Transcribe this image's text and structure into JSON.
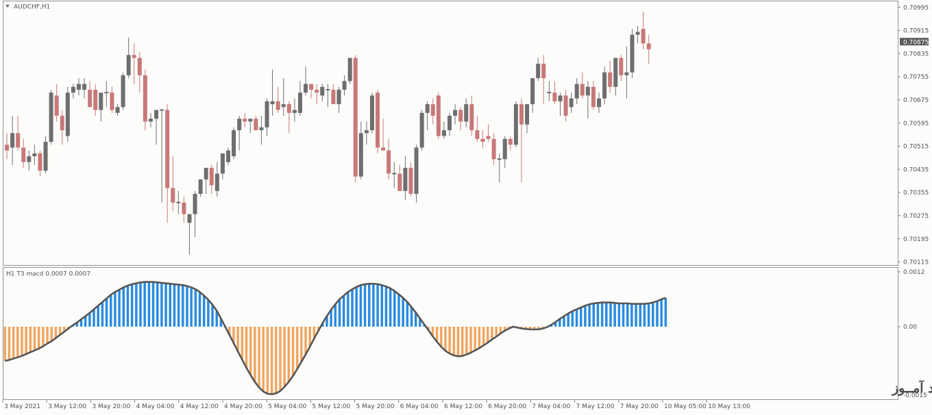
{
  "window": {
    "symbol_title": "AUDCHF,H1",
    "indicator_title": "H1 T3 macd 0.0007 0.0007",
    "watermark": "انتشار در وبسایت ســود آمــوز"
  },
  "colors": {
    "background": "#fcfcfa",
    "bull_candle": "#6e6e6e",
    "bear_candle": "#c87878",
    "pos_hist": "#2a8ce0",
    "neg_hist": "#f0a660",
    "macd_line": "#555555",
    "current_price_bg": "#5a5a5a"
  },
  "chart_data": [
    {
      "type": "candlestick",
      "title": "AUDCHF,H1",
      "price_axis": {
        "ticks": [
          "0.70995",
          "0.70915",
          "0.70835",
          "0.70755",
          "0.70675",
          "0.70595",
          "0.70515",
          "0.70435",
          "0.70355",
          "0.70275",
          "0.70195",
          "0.70115"
        ],
        "current_price": "0.70875",
        "ylim": [
          0.7011,
          0.71
        ],
        "grid": false
      },
      "time_axis": {
        "labels": [
          "3 May 2021",
          "3 May 12:00",
          "3 May 20:00",
          "4 May 04:00",
          "4 May 12:00",
          "4 May 20:00",
          "5 May 04:00",
          "5 May 12:00",
          "5 May 20:00",
          "6 May 04:00",
          "6 May 12:00",
          "6 May 20:00",
          "7 May 04:00",
          "7 May 12:00",
          "7 May 20:00",
          "10 May 05:00",
          "10 May 13:00"
        ]
      },
      "candles": [
        [
          0.7052,
          0.7056,
          0.7047,
          0.705
        ],
        [
          0.7051,
          0.7062,
          0.7045,
          0.7056
        ],
        [
          0.7056,
          0.7062,
          0.705,
          0.7051
        ],
        [
          0.7051,
          0.7054,
          0.7044,
          0.7046
        ],
        [
          0.7046,
          0.705,
          0.7043,
          0.7048
        ],
        [
          0.7048,
          0.7052,
          0.7045,
          0.7049
        ],
        [
          0.7049,
          0.705,
          0.7041,
          0.7043
        ],
        [
          0.7043,
          0.7055,
          0.7042,
          0.7053
        ],
        [
          0.7053,
          0.7071,
          0.7052,
          0.707
        ],
        [
          0.7069,
          0.7073,
          0.706,
          0.7062
        ],
        [
          0.7062,
          0.7064,
          0.7052,
          0.7057
        ],
        [
          0.7055,
          0.7072,
          0.7053,
          0.707
        ],
        [
          0.707,
          0.7073,
          0.7068,
          0.7072
        ],
        [
          0.7071,
          0.7075,
          0.7069,
          0.7073
        ],
        [
          0.7071,
          0.7075,
          0.7068,
          0.7073
        ],
        [
          0.7071,
          0.7074,
          0.7066,
          0.7065
        ],
        [
          0.7071,
          0.7073,
          0.7062,
          0.7064
        ],
        [
          0.7064,
          0.7066,
          0.706,
          0.707
        ],
        [
          0.707,
          0.7074,
          0.7065,
          0.707
        ],
        [
          0.707,
          0.7072,
          0.7063,
          0.7064
        ],
        [
          0.7063,
          0.7066,
          0.7062,
          0.7065
        ],
        [
          0.7065,
          0.7077,
          0.7064,
          0.7076
        ],
        [
          0.7076,
          0.7089,
          0.7075,
          0.7083
        ],
        [
          0.7083,
          0.7087,
          0.7073,
          0.7082
        ],
        [
          0.7082,
          0.7084,
          0.707,
          0.7076
        ],
        [
          0.7076,
          0.7078,
          0.7057,
          0.706
        ],
        [
          0.706,
          0.7063,
          0.7058,
          0.7061
        ],
        [
          0.7061,
          0.7064,
          0.7052,
          0.7064
        ],
        [
          0.7064,
          0.7064,
          0.7032,
          0.7064
        ],
        [
          0.7064,
          0.7066,
          0.7025,
          0.7037
        ],
        [
          0.7037,
          0.7048,
          0.7029,
          0.7032
        ],
        [
          0.7032,
          0.7036,
          0.7028,
          0.7032
        ],
        [
          0.7032,
          0.7034,
          0.7025,
          0.7028
        ],
        [
          0.7025,
          0.7028,
          0.7014,
          0.7028
        ],
        [
          0.7028,
          0.7036,
          0.702,
          0.7035
        ],
        [
          0.7035,
          0.704,
          0.7034,
          0.704
        ],
        [
          0.704,
          0.7042,
          0.7035,
          0.7044
        ],
        [
          0.7044,
          0.7045,
          0.7035,
          0.7038
        ],
        [
          0.7036,
          0.7046,
          0.7034,
          0.7042
        ],
        [
          0.7042,
          0.7049,
          0.704,
          0.7049
        ],
        [
          0.7046,
          0.7051,
          0.7045,
          0.705
        ],
        [
          0.7048,
          0.7058,
          0.7047,
          0.7057
        ],
        [
          0.7057,
          0.7062,
          0.705,
          0.7061
        ],
        [
          0.7061,
          0.7063,
          0.7058,
          0.706
        ],
        [
          0.706,
          0.706,
          0.7056,
          0.7061
        ],
        [
          0.7061,
          0.7062,
          0.7058,
          0.7057
        ],
        [
          0.7057,
          0.7062,
          0.7052,
          0.7058
        ],
        [
          0.7058,
          0.7068,
          0.7055,
          0.7067
        ],
        [
          0.7066,
          0.7078,
          0.7062,
          0.7067
        ],
        [
          0.7067,
          0.7072,
          0.7063,
          0.7064
        ],
        [
          0.7065,
          0.7075,
          0.7062,
          0.7066
        ],
        [
          0.7066,
          0.7067,
          0.7056,
          0.7063
        ],
        [
          0.7063,
          0.7068,
          0.706,
          0.7064
        ],
        [
          0.7063,
          0.7074,
          0.7062,
          0.707
        ],
        [
          0.707,
          0.7079,
          0.7069,
          0.7073
        ],
        [
          0.7073,
          0.7073,
          0.7068,
          0.7071
        ],
        [
          0.7071,
          0.7073,
          0.7066,
          0.707
        ],
        [
          0.7069,
          0.7073,
          0.7067,
          0.7072
        ],
        [
          0.7071,
          0.7073,
          0.7065,
          0.7071
        ],
        [
          0.7071,
          0.7073,
          0.7067,
          0.7066
        ],
        [
          0.7066,
          0.7072,
          0.7063,
          0.7071
        ],
        [
          0.7071,
          0.7076,
          0.7069,
          0.7074
        ],
        [
          0.7074,
          0.7082,
          0.7073,
          0.7082
        ],
        [
          0.7082,
          0.7083,
          0.7039,
          0.7041
        ],
        [
          0.7041,
          0.706,
          0.704,
          0.7056
        ],
        [
          0.7056,
          0.706,
          0.7052,
          0.7057
        ],
        [
          0.7057,
          0.707,
          0.7056,
          0.7069
        ],
        [
          0.707,
          0.7071,
          0.7049,
          0.7051
        ],
        [
          0.7051,
          0.7061,
          0.705,
          0.705
        ],
        [
          0.705,
          0.7054,
          0.704,
          0.7042
        ],
        [
          0.7042,
          0.7046,
          0.7037,
          0.7042
        ],
        [
          0.7042,
          0.7045,
          0.7036,
          0.7036
        ],
        [
          0.7036,
          0.7048,
          0.7033,
          0.7044
        ],
        [
          0.7044,
          0.7046,
          0.7034,
          0.7035
        ],
        [
          0.7035,
          0.7052,
          0.7032,
          0.7051
        ],
        [
          0.7051,
          0.7064,
          0.705,
          0.7063
        ],
        [
          0.7063,
          0.7067,
          0.7057,
          0.7066
        ],
        [
          0.7066,
          0.7068,
          0.7059,
          0.7062
        ],
        [
          0.7069,
          0.707,
          0.7054,
          0.7055
        ],
        [
          0.7055,
          0.706,
          0.7054,
          0.7057
        ],
        [
          0.7057,
          0.7063,
          0.7055,
          0.7062
        ],
        [
          0.7062,
          0.7066,
          0.7059,
          0.7064
        ],
        [
          0.7064,
          0.7065,
          0.7057,
          0.706
        ],
        [
          0.706,
          0.7068,
          0.7058,
          0.7066
        ],
        [
          0.7066,
          0.7069,
          0.7055,
          0.7057
        ],
        [
          0.7057,
          0.7062,
          0.7053,
          0.7054
        ],
        [
          0.7054,
          0.7057,
          0.7051,
          0.7053
        ],
        [
          0.7055,
          0.7059,
          0.7053,
          0.7054
        ],
        [
          0.7054,
          0.7056,
          0.7045,
          0.7047
        ],
        [
          0.7047,
          0.7049,
          0.7039,
          0.7047
        ],
        [
          0.7047,
          0.7055,
          0.7044,
          0.7054
        ],
        [
          0.7054,
          0.7055,
          0.705,
          0.7052
        ],
        [
          0.7052,
          0.7067,
          0.7051,
          0.7066
        ],
        [
          0.7066,
          0.7068,
          0.7039,
          0.7059
        ],
        [
          0.7059,
          0.7066,
          0.7056,
          0.7066
        ],
        [
          0.7066,
          0.7073,
          0.7063,
          0.7075
        ],
        [
          0.7075,
          0.7082,
          0.7074,
          0.708
        ],
        [
          0.708,
          0.7083,
          0.7066,
          0.7075
        ],
        [
          0.707,
          0.7074,
          0.7067,
          0.707
        ],
        [
          0.707,
          0.7074,
          0.7066,
          0.7067
        ],
        [
          0.7067,
          0.707,
          0.7062,
          0.7069
        ],
        [
          0.7069,
          0.7071,
          0.706,
          0.7062
        ],
        [
          0.7065,
          0.707,
          0.7063,
          0.7068
        ],
        [
          0.7068,
          0.7075,
          0.7066,
          0.7073
        ],
        [
          0.7073,
          0.7077,
          0.7068,
          0.7069
        ],
        [
          0.7069,
          0.7074,
          0.7061,
          0.7072
        ],
        [
          0.7072,
          0.7074,
          0.7064,
          0.7065
        ],
        [
          0.7065,
          0.707,
          0.7063,
          0.7068
        ],
        [
          0.7068,
          0.7079,
          0.7066,
          0.7077
        ],
        [
          0.7077,
          0.7081,
          0.707,
          0.7072
        ],
        [
          0.7072,
          0.7082,
          0.7069,
          0.7082
        ],
        [
          0.7082,
          0.7083,
          0.7074,
          0.7076
        ],
        [
          0.7076,
          0.7086,
          0.7068,
          0.7077
        ],
        [
          0.7077,
          0.7092,
          0.7075,
          0.709
        ],
        [
          0.709,
          0.7093,
          0.7087,
          0.7091
        ],
        [
          0.7092,
          0.7098,
          0.7085,
          0.7087
        ],
        [
          0.7087,
          0.709,
          0.708,
          0.7085
        ]
      ]
    },
    {
      "type": "bar",
      "title": "H1 T3 macd 0.0007 0.0007",
      "ylim": [
        -0.0015,
        0.0012
      ],
      "ticks": [
        "0.0012",
        "0.00",
        "-0.0015"
      ],
      "values": [
        -0.00075,
        -0.00073,
        -0.0007,
        -0.00067,
        -0.00064,
        -0.0006,
        -0.00056,
        -0.00052,
        -0.00048,
        -0.00043,
        -0.00037,
        -0.00032,
        -0.00025,
        -0.00018,
        -0.00011,
        -4e-05,
        3e-05,
        9e-05,
        0.00016,
        0.00023,
        0.0003,
        0.00038,
        0.00046,
        0.00054,
        0.00062,
        0.0007,
        0.00076,
        0.00081,
        0.00086,
        0.0009,
        0.00093,
        0.00095,
        0.00097,
        0.00098,
        0.00098,
        0.00098,
        0.00097,
        0.00096,
        0.00095,
        0.00094,
        0.00093,
        0.00092,
        0.00091,
        0.00089,
        0.00086,
        0.00082,
        0.00076,
        0.00068,
        0.00059,
        0.00048,
        0.00035,
        0.00018,
        0.0,
        -0.00018,
        -0.00036,
        -0.00054,
        -0.00072,
        -0.0009,
        -0.00106,
        -0.00121,
        -0.00133,
        -0.00142,
        -0.00147,
        -0.00148,
        -0.00146,
        -0.00141,
        -0.00132,
        -0.00121,
        -0.00108,
        -0.00093,
        -0.00077,
        -0.00061,
        -0.00044,
        -0.00026,
        -9e-05,
        8e-05,
        0.00023,
        0.00037,
        0.00049,
        0.0006,
        0.00068,
        0.00076,
        0.00082,
        0.00087,
        0.00091,
        0.00093,
        0.00094,
        0.00094,
        0.00093,
        0.00091,
        0.00088,
        0.00084,
        0.00078,
        0.00071,
        0.00063,
        0.00054,
        0.00043,
        0.00031,
        0.00018,
        5e-05,
        -8e-05,
        -0.00021,
        -0.00033,
        -0.00044,
        -0.00053,
        -0.00059,
        -0.00063,
        -0.00065,
        -0.00064,
        -0.00061,
        -0.00057,
        -0.00052,
        -0.00047,
        -0.00041,
        -0.00035,
        -0.00028,
        -0.00022,
        -0.00015,
        -9e-05,
        -4e-05,
        0.0,
        -2e-05,
        -4e-05,
        -5e-05,
        -6e-05,
        -6e-05,
        -6e-05,
        -4e-05,
        -1e-05,
        4e-05,
        0.0001,
        0.00017,
        0.00023,
        0.00029,
        0.00034,
        0.00038,
        0.00042,
        0.00046,
        0.00049,
        0.00051,
        0.00052,
        0.00053,
        0.00053,
        0.00053,
        0.00052,
        0.00051,
        0.00051,
        0.00051,
        0.0005,
        0.0005,
        0.0005,
        0.0005,
        0.00051,
        0.00053,
        0.00056,
        0.0006,
        0.00063
      ]
    }
  ]
}
